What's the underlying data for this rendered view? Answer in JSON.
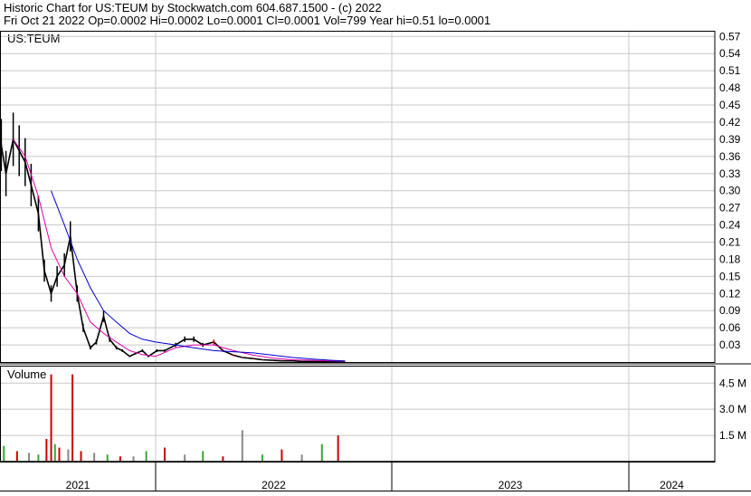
{
  "header": {
    "line1": "Historic Chart for US:TEUM by Stockwatch.com 604.687.1500 - (c) 2022",
    "line2": "Fri Oct 21 2022   Op=0.0002   Hi=0.0002   Lo=0.0001   Cl=0.0001   Vol=799   Year hi=0.51   lo=0.0001"
  },
  "colors": {
    "background": "#ffffff",
    "grid": "#c8c8c8",
    "frame": "#000000",
    "price_up": "#000000",
    "price_down": "#cc0000",
    "ma_short": "#dd00aa",
    "ma_long": "#0000cc",
    "volume_up": "#33aa33",
    "volume_down": "#cc0000",
    "volume_neutral": "#888888"
  },
  "chart_data": [
    {
      "type": "line",
      "title": "US:TEUM",
      "symbol_label": "US:TEUM",
      "y_ticks": [
        "0.03",
        "0.06",
        "0.09",
        "0.12",
        "0.15",
        "0.18",
        "0.21",
        "0.24",
        "0.27",
        "0.30",
        "0.33",
        "0.36",
        "0.39",
        "0.42",
        "0.45",
        "0.48",
        "0.51",
        "0.54",
        "0.57"
      ],
      "ylim": [
        0.0,
        0.58
      ],
      "x_labels": [
        "2021",
        "2022",
        "2023",
        "2024"
      ],
      "grid": true,
      "series": [
        {
          "style": "daily-high-low-bars",
          "x": [
            "2021-01-04",
            "2021-01-15",
            "2021-02-01",
            "2021-02-15",
            "2021-03-01",
            "2021-03-15",
            "2021-04-01",
            "2021-04-15",
            "2021-05-01",
            "2021-05-15",
            "2021-06-01",
            "2021-06-15",
            "2021-07-01",
            "2021-07-15",
            "2021-08-01",
            "2021-08-15",
            "2021-09-01",
            "2021-09-15",
            "2021-10-01",
            "2021-10-15",
            "2021-11-01",
            "2021-11-15",
            "2021-12-01",
            "2021-12-15",
            "2022-01-03",
            "2022-01-15",
            "2022-02-01",
            "2022-02-15",
            "2022-03-01",
            "2022-03-15",
            "2022-04-01",
            "2022-04-15",
            "2022-05-01",
            "2022-05-15",
            "2022-06-01",
            "2022-06-15",
            "2022-07-01",
            "2022-07-15",
            "2022-08-01",
            "2022-08-15",
            "2022-09-01",
            "2022-09-15",
            "2022-10-01",
            "2022-10-21"
          ],
          "values": [
            0.38,
            0.33,
            0.39,
            0.37,
            0.35,
            0.31,
            0.26,
            0.16,
            0.12,
            0.15,
            0.17,
            0.22,
            0.12,
            0.06,
            0.025,
            0.035,
            0.08,
            0.04,
            0.025,
            0.02,
            0.01,
            0.015,
            0.02,
            0.01,
            0.02,
            0.02,
            0.03,
            0.04,
            0.04,
            0.03,
            0.035,
            0.02,
            0.012,
            0.008,
            0.006,
            0.004,
            0.003,
            0.002,
            0.002,
            0.001,
            0.001,
            0.0008,
            0.0004,
            0.0001
          ]
        },
        {
          "style": "moving-average-short",
          "x": [
            "2021-02-01",
            "2021-03-01",
            "2021-04-01",
            "2021-05-01",
            "2021-06-01",
            "2021-07-01",
            "2021-08-01",
            "2021-09-01",
            "2021-10-01",
            "2021-11-01",
            "2021-12-01",
            "2022-01-01",
            "2022-02-01",
            "2022-03-01",
            "2022-04-01",
            "2022-05-01",
            "2022-06-01",
            "2022-07-01",
            "2022-08-01",
            "2022-09-01",
            "2022-10-01",
            "2022-10-21"
          ],
          "values": [
            0.39,
            0.36,
            0.29,
            0.2,
            0.15,
            0.12,
            0.07,
            0.05,
            0.035,
            0.02,
            0.013,
            0.01,
            0.025,
            0.03,
            0.03,
            0.02,
            0.012,
            0.007,
            0.004,
            0.003,
            0.002,
            0.0015
          ]
        },
        {
          "style": "moving-average-long",
          "x": [
            "2021-05-01",
            "2021-06-01",
            "2021-07-01",
            "2021-08-01",
            "2021-09-01",
            "2021-10-01",
            "2021-11-01",
            "2021-12-01",
            "2022-01-01",
            "2022-02-01",
            "2022-03-01",
            "2022-04-01",
            "2022-05-01",
            "2022-06-01",
            "2022-07-01",
            "2022-08-01",
            "2022-09-01",
            "2022-10-01",
            "2022-10-21"
          ],
          "values": [
            0.3,
            0.24,
            0.18,
            0.13,
            0.09,
            0.07,
            0.05,
            0.04,
            0.035,
            0.03,
            0.025,
            0.02,
            0.018,
            0.016,
            0.012,
            0.008,
            0.005,
            0.003,
            0.002
          ]
        }
      ]
    },
    {
      "type": "bar",
      "title": "Volume",
      "y_ticks": [
        "1.5 M",
        "3.0 M",
        "4.5 M"
      ],
      "ylim": [
        0,
        5.5
      ],
      "unit": "M",
      "grid": true,
      "series": [
        {
          "style": "volume-bars",
          "x": [
            "2021-01-10",
            "2021-02-10",
            "2021-03-10",
            "2021-04-01",
            "2021-04-20",
            "2021-05-01",
            "2021-05-10",
            "2021-05-20",
            "2021-06-10",
            "2021-06-20",
            "2021-07-10",
            "2021-08-10",
            "2021-09-10",
            "2021-10-10",
            "2021-11-10",
            "2021-12-10",
            "2022-01-15",
            "2022-02-15",
            "2022-03-15",
            "2022-04-15",
            "2022-05-15",
            "2022-06-15",
            "2022-07-15",
            "2022-08-15",
            "2022-09-15",
            "2022-10-10"
          ],
          "values": [
            0.9,
            0.6,
            0.5,
            0.4,
            1.3,
            5.0,
            1.0,
            0.8,
            0.7,
            5.0,
            0.6,
            0.5,
            0.4,
            0.3,
            0.3,
            0.6,
            0.8,
            0.4,
            0.6,
            0.3,
            1.8,
            0.4,
            0.7,
            0.4,
            1.0,
            1.5
          ]
        }
      ]
    }
  ]
}
